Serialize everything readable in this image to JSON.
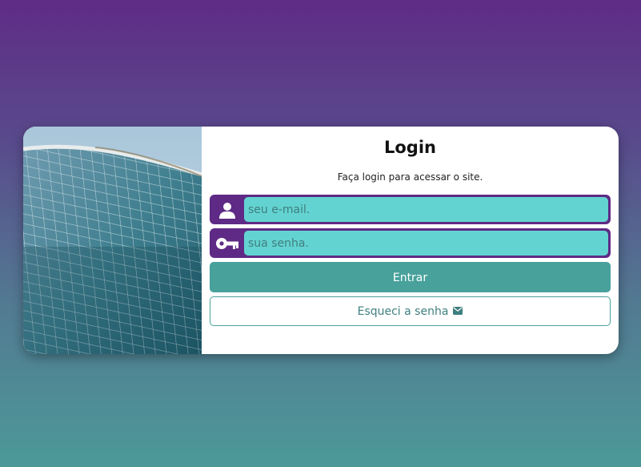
{
  "login": {
    "title": "Login",
    "subtitle": "Faça login para acessar o site.",
    "email": {
      "placeholder": "seu e-mail.",
      "value": "",
      "icon": "user-icon"
    },
    "password": {
      "placeholder": "sua senha.",
      "value": "",
      "icon": "key-icon"
    },
    "submit_label": "Entrar",
    "forgot_label": "Esqueci a senha",
    "forgot_icon": "envelope-icon"
  },
  "colors": {
    "background_top": "#5f2c86",
    "background_bottom": "#4c9998",
    "field_border": "#5e2a85",
    "field_fill": "#63d3d1",
    "accent": "#48a19b"
  }
}
